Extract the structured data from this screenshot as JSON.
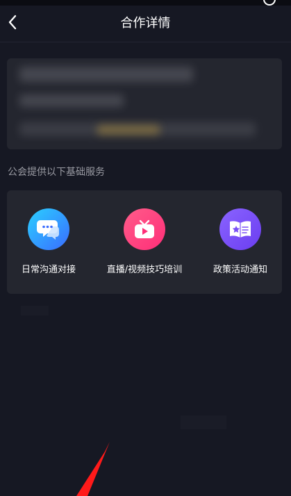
{
  "nav": {
    "title": "合作详情"
  },
  "section": {
    "label": "公会提供以下基础服务"
  },
  "services": [
    {
      "label": "日常沟通对接",
      "icon": "chat-bubbles-icon"
    },
    {
      "label": "直播/视频技巧培训",
      "icon": "tv-play-icon"
    },
    {
      "label": "政策活动通知",
      "icon": "book-star-icon"
    }
  ],
  "colors": {
    "background": "#161823",
    "card": "#24262f",
    "annotation_arrow": "#ff1a1a"
  }
}
